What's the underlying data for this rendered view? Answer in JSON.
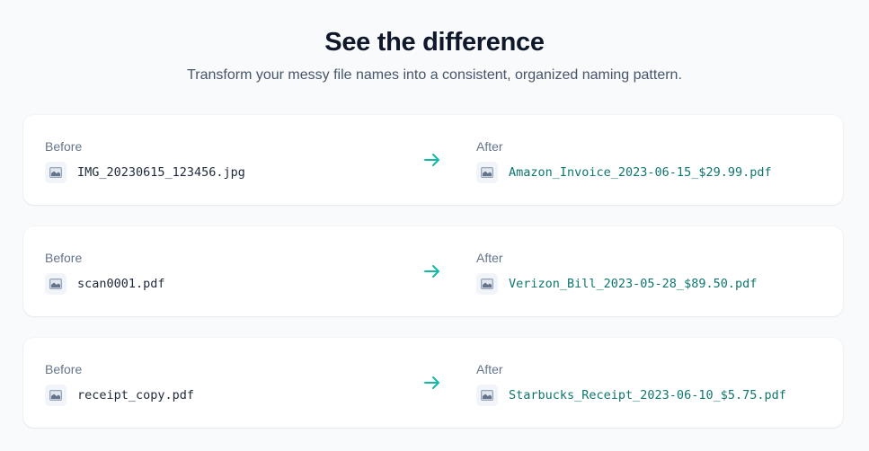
{
  "header": {
    "title": "See the difference",
    "subtitle": "Transform your messy file names into a consistent, organized naming pattern."
  },
  "labels": {
    "before": "Before",
    "after": "After"
  },
  "icons": {
    "file": "image-file-icon",
    "arrow": "arrow-right-icon"
  },
  "colors": {
    "accent": "#14b8a6",
    "renamed_text": "#0f766e",
    "original_text": "#1e293b"
  },
  "examples": [
    {
      "before": "IMG_20230615_123456.jpg",
      "after": "Amazon_Invoice_2023-06-15_$29.99.pdf"
    },
    {
      "before": "scan0001.pdf",
      "after": "Verizon_Bill_2023-05-28_$89.50.pdf"
    },
    {
      "before": "receipt_copy.pdf",
      "after": "Starbucks_Receipt_2023-06-10_$5.75.pdf"
    }
  ]
}
